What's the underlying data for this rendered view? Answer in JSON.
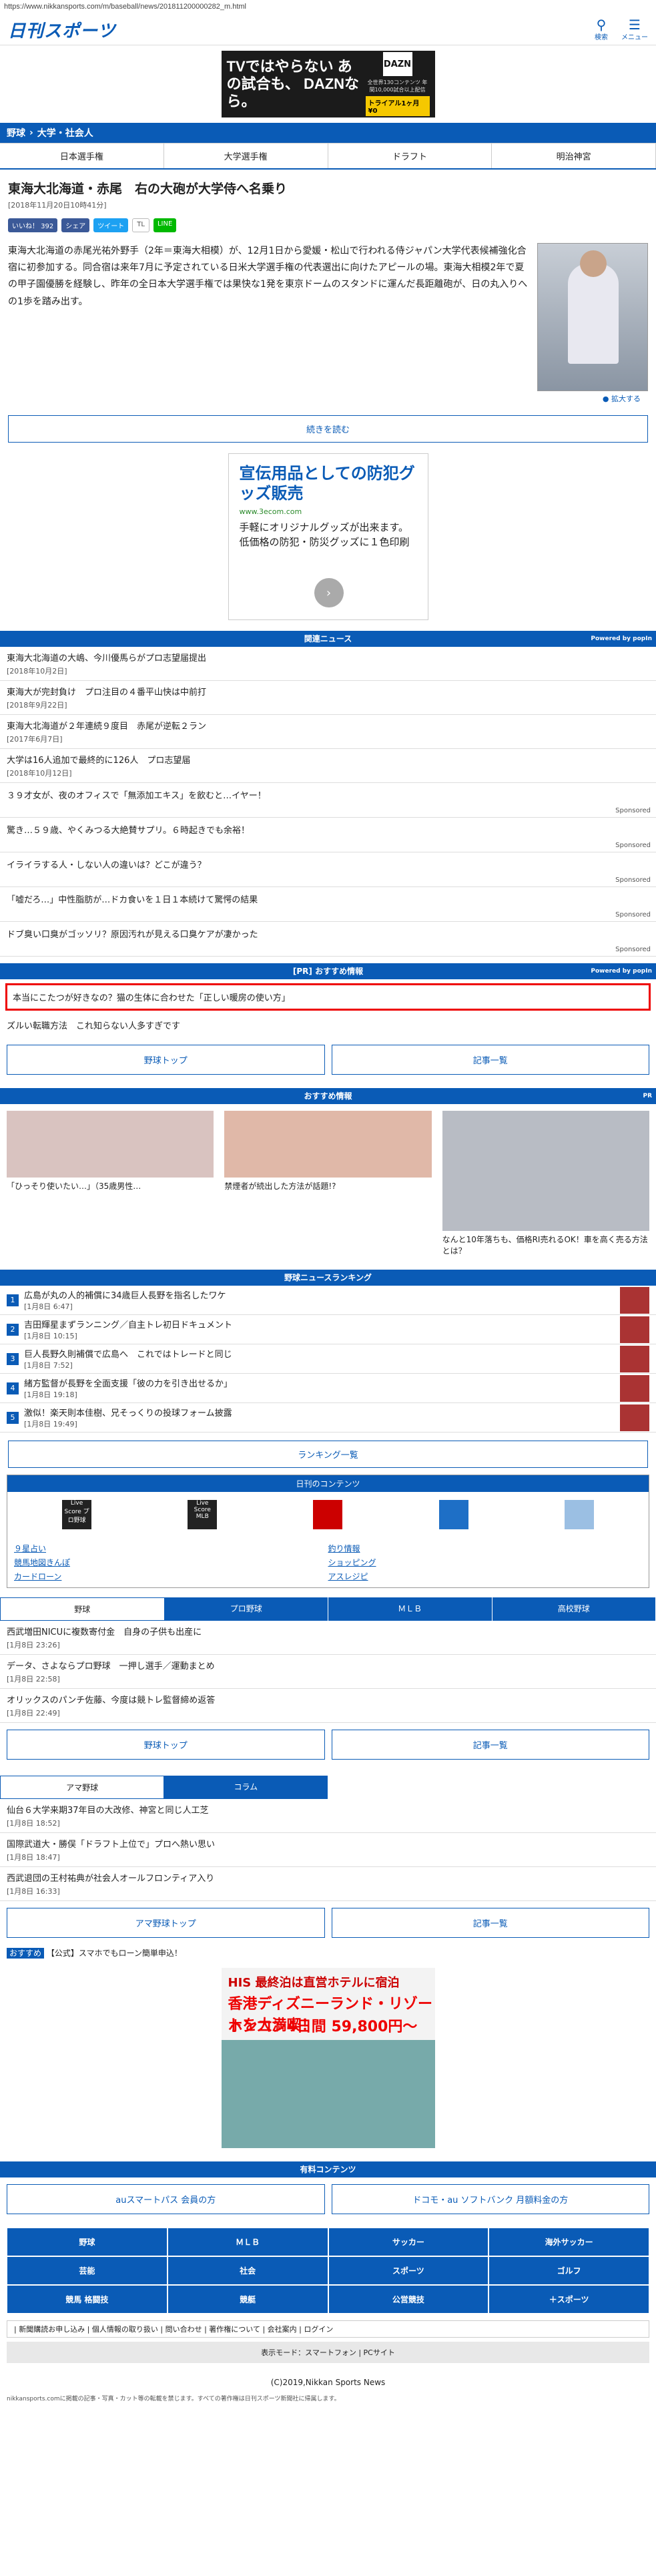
{
  "url": "https://www.nikkansports.com/m/baseball/news/201811200000282_m.html",
  "logo": "日刊スポーツ",
  "top_icons": {
    "search": "検索",
    "menu": "メニュー"
  },
  "ad_top": {
    "headline": "TVではやらない あの試合も、 DAZNなら。",
    "brand": "DAZN",
    "small": "全世界130コンテンツ 年間10,000試合以上配信",
    "trial": "トライアル1ヶ月 ¥0"
  },
  "breadcrumb": {
    "a": "野球",
    "b": "大学・社会人"
  },
  "tabs": [
    "日本選手権",
    "大学選手権",
    "ドラフト",
    "明治神宮"
  ],
  "article": {
    "title": "東海大北海道・赤尾　右の大砲が大学侍へ名乗り",
    "date": "[2018年11月20日10時41分]",
    "share": {
      "fb": "いいね！ 392",
      "fbshare": "シェア",
      "tw": "ツイート",
      "tl": "TL",
      "ln": "LINE"
    },
    "body": "東海大北海道の赤尾光祐外野手（2年＝東海大相模）が、12月1日から愛媛・松山で行われる侍ジャパン大学代表候補強化合宿に初参加する。同合宿は来年7月に予定されている日米大学選手権の代表選出に向けたアピールの場。東海大相模2年で夏の甲子園優勝を経験し、昨年の全日本大学選手権では果快な1発を東京ドームのスタンドに運んだ長距離砲が、日の丸入りへの1歩を踏み出す。",
    "photo_caption": "拡大する",
    "more": "続きを読む"
  },
  "ad_mid": {
    "headline": "宣伝用品としての防犯グッズ販売",
    "url": "www.3ecom.com",
    "desc": "手軽にオリジナルグッズが出来ます。低価格の防犯・防災グッズに１色印刷"
  },
  "related": {
    "title": "関連ニュース",
    "powered": "Powered by popIn",
    "items": [
      {
        "t": "東海大北海道の大嶋、今川優馬らがプロ志望届提出",
        "d": "[2018年10月2日]"
      },
      {
        "t": "東海大が完封負け　プロ注目の４番平山快は中前打",
        "d": "[2018年9月22日]"
      },
      {
        "t": "東海大北海道が２年連続９度目　赤尾が逆転２ラン",
        "d": "[2017年6月7日]"
      },
      {
        "t": "大学は16人追加で最終的に126人　プロ志望届",
        "d": "[2018年10月12日]"
      }
    ],
    "sponsored": [
      "３９才女が、夜のオフィスで「無添加エキス」を飲むと…イヤー！",
      "驚き…５９歳、やくみつる大絶賛サプリ。６時起きでも余裕！",
      "イライラする人・しない人の違いは？どこが違う？",
      "「嘘だろ…」中性脂肪が…ドカ食いを１日１本続けて驚愕の結果",
      "ドブ臭い口臭がゴッソリ？原因汚れが見える口臭ケアが凄かった"
    ],
    "sponsored_label": "Sponsored"
  },
  "pr": {
    "title": "[PR] おすすめ情報",
    "items": [
      "本当にこたつが好きなの？猫の生体に合わせた「正しい暖房の使い方」",
      "ズルい転職方法　これ知らない人多すぎです"
    ]
  },
  "btn_baseball_top": "野球トップ",
  "btn_list": "記事一覧",
  "recommend": {
    "title": "おすすめ情報",
    "pr": "PR",
    "items": [
      "「ひっそり使いたい…」（35歳男性…",
      "禁煙者が続出した方法が話題!?",
      "なんと10年落ちも、価格RI売れるOK！車を高く売る方法とは？"
    ]
  },
  "ranking": {
    "title": "野球ニュースランキング",
    "items": [
      {
        "t": "広島が丸の人的補償に34歳巨人長野を指名したワケ",
        "d": "[1月8日 6:47]"
      },
      {
        "t": "吉田輝星まずランニング／自主トレ初日ドキュメント",
        "d": "[1月8日 10:15]"
      },
      {
        "t": "巨人長野久則補償で広島へ　これではトレードと同じ",
        "d": "[1月8日 7:52]"
      },
      {
        "t": "緒方監督が長野を全面支援「彼の力を引き出せるか」",
        "d": "[1月8日 19:18]"
      },
      {
        "t": "激似！楽天則本佳樹、兄そっくりの投球フォーム披露",
        "d": "[1月8日 19:49]"
      }
    ],
    "more": "ランキング一覧"
  },
  "contents": {
    "title": "日刊のコンテンツ",
    "icons": [
      "Live Score プロ野球",
      "Live Score MLB",
      "",
      "",
      ""
    ],
    "links_left": [
      "９星占い",
      "競馬地図きんぽ",
      "カードローン"
    ],
    "links_right": [
      "釣り情報",
      "ショッピング",
      "アスレジピ"
    ]
  },
  "tabs_bottom": [
    "野球",
    "プロ野球",
    "ＭＬＢ",
    "高校野球"
  ],
  "baseball_news": [
    {
      "t": "西武増田NICUに複数寄付金　自身の子供も出産に",
      "d": "[1月8日 23:26]"
    },
    {
      "t": "データ、さよならプロ野球　一押し選手／運動まとめ",
      "d": "[1月8日 22:58]"
    },
    {
      "t": "オリックスのパンチ佐藤、今度は競トレ監督締め返答",
      "d": "[1月8日 22:49]"
    }
  ],
  "tabs_ama": [
    "アマ野球",
    "コラム"
  ],
  "ama_news": [
    {
      "t": "仙台６大学来期37年目の大改修、神宮と同じ人工芝",
      "d": "[1月8日 18:52]"
    },
    {
      "t": "国際武道大・勝俣「ドラフト上位で」プロへ熱い思い",
      "d": "[1月8日 18:47]"
    },
    {
      "t": "西武退団の王村祐典が社会人オールフロンティア入り",
      "d": "[1月8日 16:33]"
    }
  ],
  "btn_ama_top": "アマ野球トップ",
  "osusume": {
    "label": "おすすめ",
    "text": "【公式】スマホでもローン簡単申込！"
  },
  "ad_his": {
    "h1": "HIS 最終泊は直営ホテルに宿泊",
    "h2": "香港ディズニーランド・リゾートを大満喫！",
    "h3": "ホンコン4日間 59,800円～"
  },
  "paid": {
    "title": "有料コンテンツ",
    "a": "auスマートパス 会員の方",
    "b": "ドコモ・au ソフトバンク 月額料金の方"
  },
  "footer_nav": [
    "野球",
    "ＭＬＢ",
    "サッカー",
    "海外サッカー",
    "芸能",
    "社会",
    "スポーツ",
    "ゴルフ",
    "競馬 格闘技",
    "競艇",
    "公営競技",
    "＋スポーツ"
  ],
  "footer_links": "| 新聞購読お申し込み | 個人情報の取り扱い | 問い合わせ | 著作権について | 会社案内 | ログイン",
  "display_mode": "表示モード：スマートフォン | PCサイト",
  "copyright": "(C)2019,Nikkan Sports News",
  "fine": "nikkansports.comに掲載の記事・写真・カット等の転載を禁じます。すべての著作権は日刊スポーツ新聞社に帰属します。"
}
